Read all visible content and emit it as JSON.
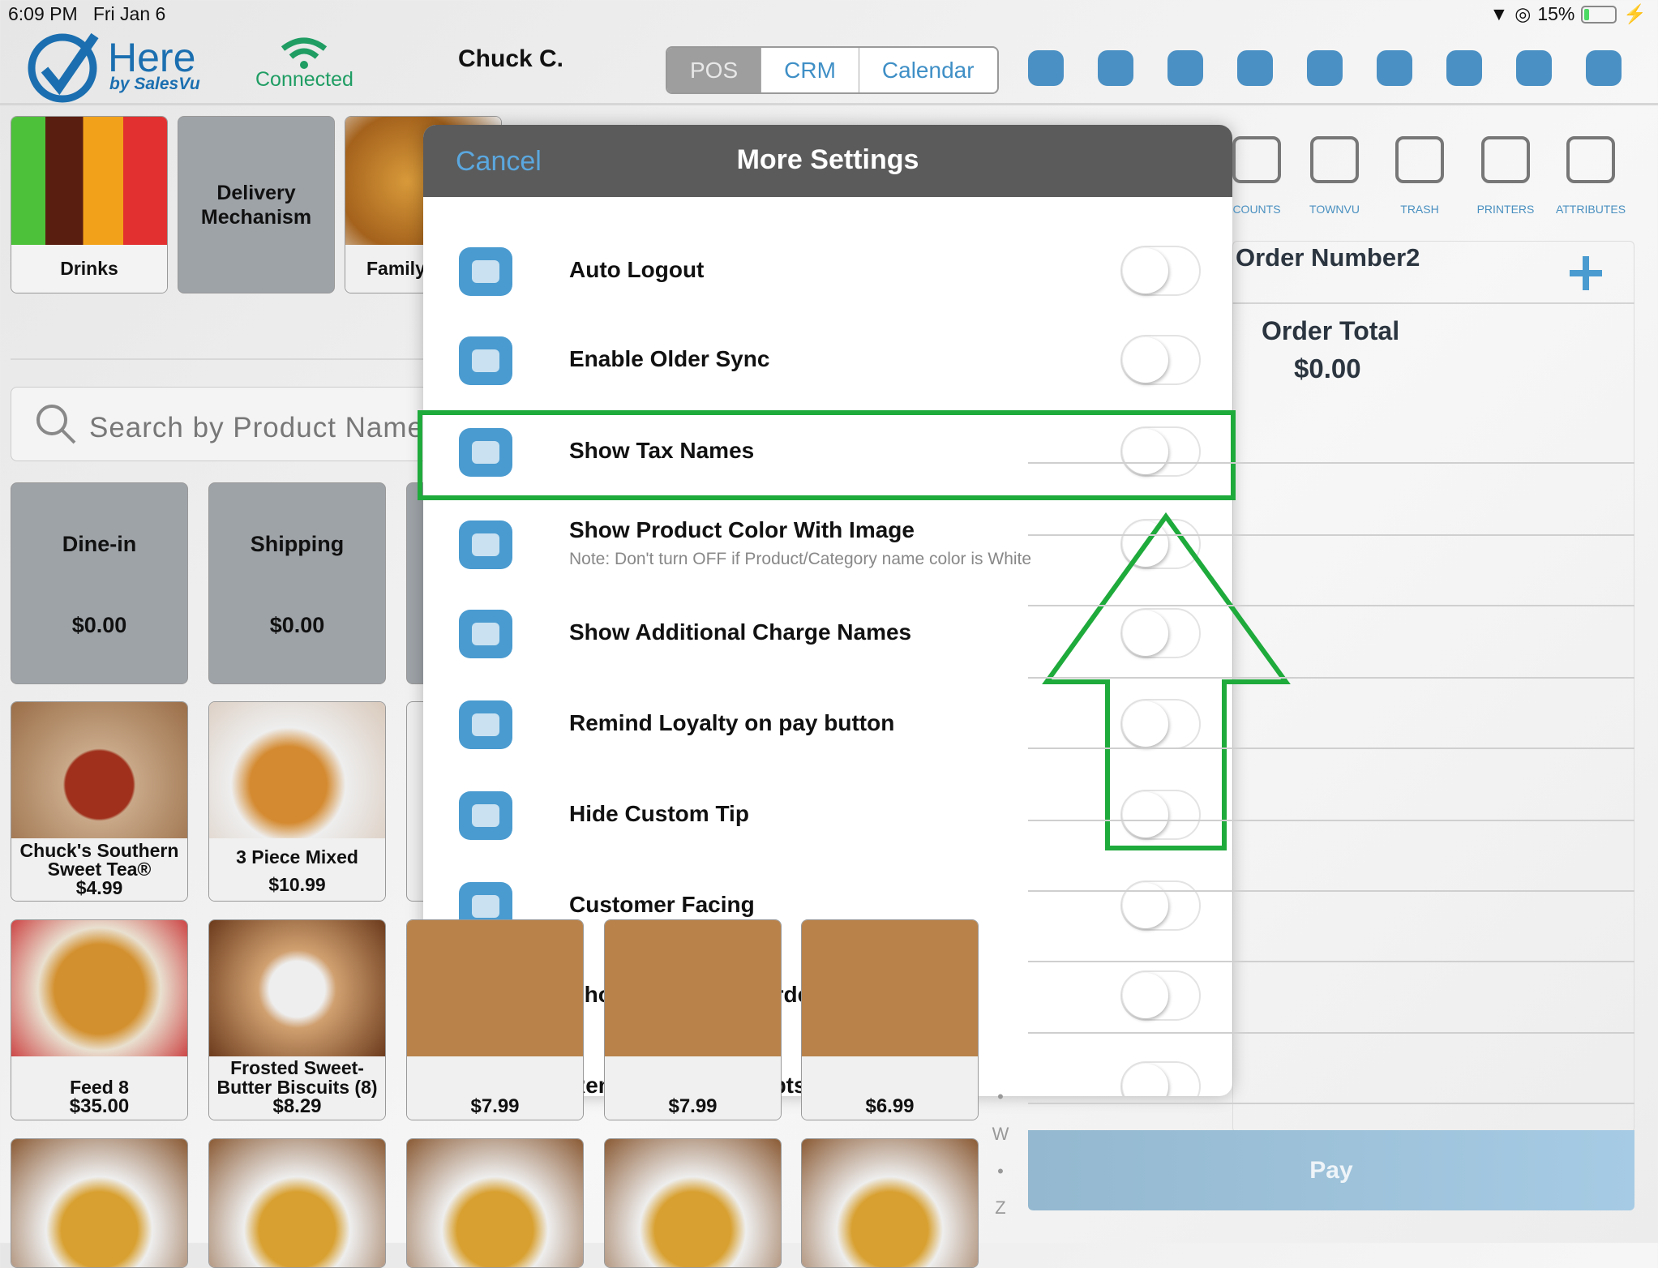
{
  "status_bar": {
    "time": "6:09 PM",
    "date": "Fri Jan 6",
    "battery": "15%",
    "battery_level": 0.15
  },
  "header": {
    "logo_text": "Here",
    "logo_sub": "by SalesVu",
    "connection": "Connected",
    "user": "Chuck C.",
    "tabs": [
      {
        "label": "POS",
        "active": true
      },
      {
        "label": "CRM",
        "active": false
      },
      {
        "label": "Calendar",
        "active": false
      }
    ],
    "icons": [
      "timesheet-icon",
      "chat-icon",
      "cash-drawer-icon",
      "transfer-icon",
      "alarm-icon",
      "wallet-icon",
      "piggy-bank-icon",
      "settings-gear-icon",
      "logout-icon"
    ]
  },
  "categories": [
    {
      "label": "Drinks"
    },
    {
      "label": "Delivery Mechanism"
    },
    {
      "label": "Family"
    }
  ],
  "search": {
    "placeholder": "Search by Product Name"
  },
  "order_types": [
    {
      "label": "Dine-in",
      "price": "$0.00"
    },
    {
      "label": "Shipping",
      "price": "$0.00"
    }
  ],
  "products_row1": [
    {
      "name": "Chuck's Southern Sweet Tea®",
      "price": "$4.99"
    },
    {
      "name": "3 Piece Mixed",
      "price": "$10.99"
    }
  ],
  "products_row2": [
    {
      "name": "Feed 8",
      "price": "$35.00"
    },
    {
      "name": "Frosted Sweet-Butter Biscuits (8)",
      "price": "$8.29"
    },
    {
      "name": "",
      "price": "$7.99"
    },
    {
      "name": "",
      "price": "$7.99"
    },
    {
      "name": "",
      "price": "$6.99"
    }
  ],
  "alphabet_index": [
    "•",
    "W",
    "•",
    "Z"
  ],
  "toolbar": [
    {
      "label": "COUNTS"
    },
    {
      "label": "TOWNVU"
    },
    {
      "label": "TRASH"
    },
    {
      "label": "PRINTERS"
    },
    {
      "label": "ATTRIBUTES"
    }
  ],
  "order": {
    "title": "Order Number2",
    "total_label": "Order Total",
    "total": "$0.00",
    "pay_label": "Pay"
  },
  "modal": {
    "cancel_label": "Cancel",
    "title": "More Settings",
    "settings": [
      {
        "label": "Auto Logout",
        "icon": "logout-door-icon",
        "on": false
      },
      {
        "label": "Enable Older Sync",
        "icon": "sync-icon",
        "on": false
      },
      {
        "label": "Show Tax Names",
        "icon": "tax-percent-icon",
        "on": false,
        "highlighted": true
      },
      {
        "label": "Show Product Color With Image",
        "note": "Note: Don't turn OFF if Product/Category name color is White",
        "icon": "palette-icon",
        "on": false
      },
      {
        "label": "Show Additional Charge Names",
        "icon": "additional-charge-icon",
        "on": false
      },
      {
        "label": "Remind Loyalty on pay button",
        "icon": "alert-bell-icon",
        "on": false
      },
      {
        "label": "Hide Custom Tip",
        "icon": "tip-hand-icon",
        "on": false
      },
      {
        "label": "Customer Facing",
        "icon": "customer-facing-icon",
        "on": false
      },
      {
        "label": "Show Order Id in Order List View",
        "icon": "list-icon",
        "on": false
      },
      {
        "label": "Remove SMS receipts",
        "icon": "edit-square-icon",
        "on": false
      }
    ]
  },
  "colors": {
    "accent": "#4a9bd0",
    "highlight": "#1faa3c",
    "modal_header": "#5b5b5b",
    "connected": "#1f9d63"
  }
}
